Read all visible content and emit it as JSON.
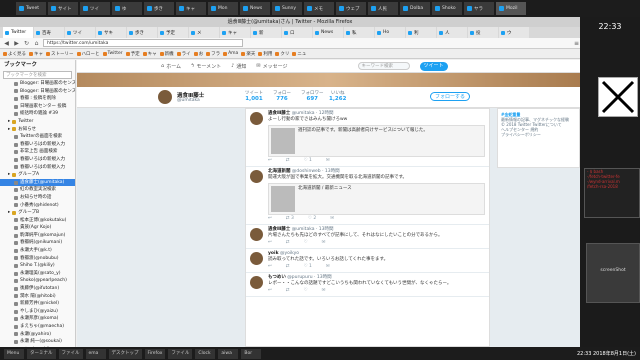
{
  "system": {
    "tabs": [
      "Tweet",
      "サイト",
      "ツイ",
      "ゆ",
      "歩き",
      "キャ",
      "Mon",
      "News",
      "Sunny",
      "メモ",
      "ウェブ",
      "人民",
      "Dolba",
      "Shoko",
      "ヤラ",
      "Mozil"
    ],
    "clock": "22:33",
    "date": "2018年8月1日(土)"
  },
  "firefox": {
    "title": "過食Ⅲ藤士(@umitaka)さん | Twitter - Mozilla Firefox",
    "tabs": [
      "Twitter",
      "百寿",
      "ツイ",
      "サキ",
      "歩き",
      "予定",
      "メ",
      "キャ",
      "新",
      "ロ",
      "News",
      "私",
      "Ho",
      "利",
      "人",
      "投",
      "ウ"
    ],
    "url": "https://twitter.com/umitaka",
    "bookmarks": [
      "よく見る",
      "キャ",
      "ストーリー",
      "ハローと",
      "Twitter",
      "予定",
      "キャ",
      "新機",
      "ライ",
      "お",
      "フラ",
      "Ama",
      "楽天",
      "利用",
      "クリ",
      "ニュ"
    ]
  },
  "sidebar": {
    "title": "ブックマーク",
    "search_placeholder": "ブックマークを検索",
    "items": [
      {
        "label": "Blogger: 日曜画家のセンス",
        "type": "link"
      },
      {
        "label": "Blogger: 日曜画家のセンス",
        "type": "link"
      },
      {
        "label": "春瓣 : 投稿を削除",
        "type": "link"
      },
      {
        "label": "日曜画家センター 投稿",
        "type": "link"
      },
      {
        "label": "総括時の雑論 #39",
        "type": "link"
      },
      {
        "label": "Twitter",
        "type": "folder"
      },
      {
        "label": "お知らせ",
        "type": "folder"
      },
      {
        "label": "Twitterの画面を検索",
        "type": "link"
      },
      {
        "label": "春瓣いろはの新規入力",
        "type": "link"
      },
      {
        "label": "非常上告 画面検索",
        "type": "link"
      },
      {
        "label": "春瓣いろはの新規入力",
        "type": "link"
      },
      {
        "label": "春瓣いろはの新規入力",
        "type": "link"
      },
      {
        "label": "グループA",
        "type": "folder"
      },
      {
        "label": "過食藤士(@umitaka)",
        "type": "link",
        "selected": true
      },
      {
        "label": "紅の教室実況検索",
        "type": "link"
      },
      {
        "label": "お知らせ時の話",
        "type": "link"
      },
      {
        "label": "小番秀(@hidenot)",
        "type": "link"
      },
      {
        "label": "グループB",
        "type": "folder"
      },
      {
        "label": "松本正博(@kokutaku)",
        "type": "link"
      },
      {
        "label": "貴族(Agr Kojo)",
        "type": "link"
      },
      {
        "label": "駒澤純平(@komajun)",
        "type": "link"
      },
      {
        "label": "春瓣純(@nikumani)",
        "type": "link"
      },
      {
        "label": "永瀬大手(@k.t)",
        "type": "link"
      },
      {
        "label": "春瓣渡(@nobubu)",
        "type": "link"
      },
      {
        "label": "Shiho T.(@kiliy)",
        "type": "link"
      },
      {
        "label": "永瀬理美(@sato_y)",
        "type": "link"
      },
      {
        "label": "Shoko(@pearlpeach)",
        "type": "link"
      },
      {
        "label": "後藤伊(@ifutotan)",
        "type": "link"
      },
      {
        "label": "潤水 陽(@hitobi)",
        "type": "link"
      },
      {
        "label": "新藤芳井(@nickel)",
        "type": "link"
      },
      {
        "label": "やしまひ(@yaizu)",
        "type": "link"
      },
      {
        "label": "永瀬邦彦(@koma)",
        "type": "link"
      },
      {
        "label": "まえちゃ(@maecha)",
        "type": "link"
      },
      {
        "label": "永瀬(@yahiro)",
        "type": "link"
      },
      {
        "label": "永瀬 純一(@soukai)",
        "type": "link"
      },
      {
        "label": "yotsu(@yuki)",
        "type": "link"
      }
    ]
  },
  "twitter": {
    "nav": [
      "ホーム",
      "モーメント",
      "通知",
      "メッセージ"
    ],
    "search_placeholder": "キーワード検索",
    "tweet_button": "ツイート",
    "profile": {
      "name": "過食Ⅲ藤士",
      "handle": "@umitaka",
      "stats": [
        {
          "label": "ツイート",
          "value": "1,001"
        },
        {
          "label": "フォロー",
          "value": "776"
        },
        {
          "label": "フォロワー",
          "value": "697"
        },
        {
          "label": "いいね",
          "value": "1,262"
        }
      ],
      "follow_button": "フォローする"
    },
    "tweets": [
      {
        "name": "過食Ⅲ藤士",
        "meta": "@umitaka · 12時間",
        "text": "よーし行動の家でさはみんち聞けろww",
        "has_image": true,
        "image_text": "週刊誌の記事です。新聞は高齢者向けサービスについて報じた。",
        "retweets": "",
        "likes": "1"
      },
      {
        "name": "北海道新聞",
        "meta": "@doshinweb · 13時間",
        "text": "開運大阪が国で事業を拡大。交通機関を取る北海道新聞の記事です。",
        "has_image": true,
        "image_text": "北海道新聞 / 最新ニュース",
        "retweets": "3",
        "likes": "2"
      },
      {
        "name": "過食Ⅲ藤士",
        "meta": "@umitaka · 13時間",
        "text": "片場さんたちも先ほどのすべてが記事にして、それはなにしたいことの分であるから。",
        "has_image": false,
        "image_text": "",
        "retweets": "",
        "likes": ""
      },
      {
        "name": "yoik",
        "meta": "@yoikyo",
        "text": "読み取ってれた話です。いろいろお話してくれた事をます。",
        "has_image": false,
        "image_text": "",
        "retweets": "",
        "likes": "1"
      },
      {
        "name": "もつめい",
        "meta": "@purupuru · 13時間",
        "text": "レポー・・こんなの話題ですどこいうちも関われていなくてもいう世間が、なくゃたらー。",
        "has_image": false,
        "image_text": "",
        "retweets": "",
        "likes": ""
      }
    ],
    "right_panel": {
      "title": "#金蛇重量",
      "lines": [
        "最新情報の記事、マグネチックな経験",
        "© 2018 Twitter  Twitterについて",
        "ヘルプセンター 規約",
        "プライバシーポリシー"
      ]
    }
  },
  "right_panel": {
    "terminal_lines": [
      "- $ bash",
      "-/fetch-twitter-fe",
      "-/wynd-arrival.m",
      "/fetch-rsa-2018"
    ],
    "screenshot_label": "screenShot"
  },
  "taskbar": {
    "items": [
      "Menu",
      "ターミナル",
      "ファイル",
      "ema",
      "デスクトップ",
      "Firefox",
      "ファイル",
      "Clock",
      "aiwa",
      "Bor"
    ],
    "clock": "22:33"
  }
}
